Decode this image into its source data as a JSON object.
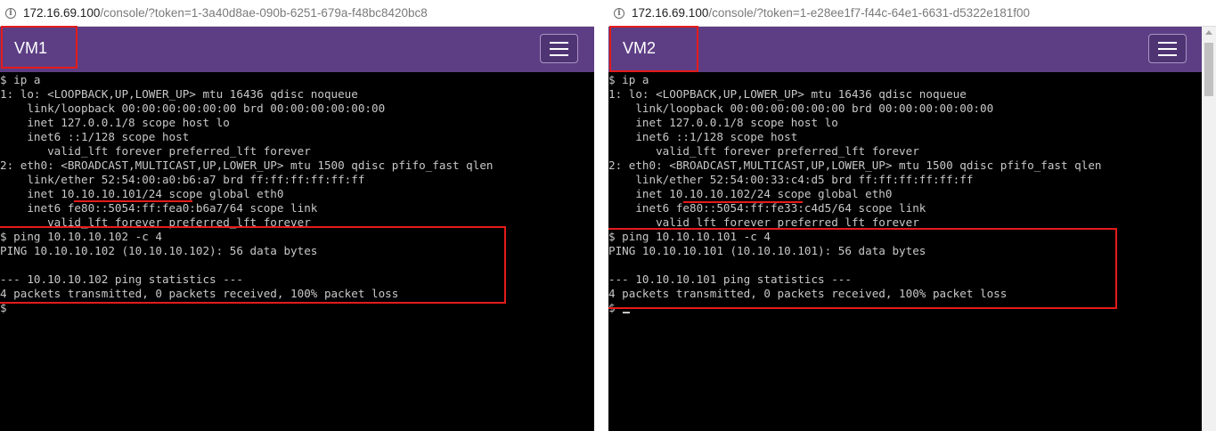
{
  "vm1": {
    "url": {
      "host": "172.16.69.100",
      "path": "/console/?token=1-3a40d8ae-090b-6251-679a-f48bc8420bc8"
    },
    "title": "VM1",
    "terminal_lines": [
      "$ ip a",
      "1: lo: <LOOPBACK,UP,LOWER_UP> mtu 16436 qdisc noqueue",
      "    link/loopback 00:00:00:00:00:00 brd 00:00:00:00:00:00",
      "    inet 127.0.0.1/8 scope host lo",
      "    inet6 ::1/128 scope host",
      "       valid_lft forever preferred_lft forever",
      "2: eth0: <BROADCAST,MULTICAST,UP,LOWER_UP> mtu 1500 qdisc pfifo_fast qlen",
      "    link/ether 52:54:00:a0:b6:a7 brd ff:ff:ff:ff:ff:ff",
      "    inet 10.10.10.101/24 scope global eth0",
      "    inet6 fe80::5054:ff:fea0:b6a7/64 scope link",
      "       valid_lft forever preferred_lft forever",
      "$ ping 10.10.10.102 -c 4",
      "PING 10.10.10.102 (10.10.10.102): 56 data bytes",
      "",
      "--- 10.10.10.102 ping statistics ---",
      "4 packets transmitted, 0 packets received, 100% packet loss",
      "$"
    ]
  },
  "vm2": {
    "url": {
      "host": "172.16.69.100",
      "path": "/console/?token=1-e28ee1f7-f44c-64e1-6631-d5322e181f00"
    },
    "title": "VM2",
    "terminal_lines": [
      "$ ip a",
      "1: lo: <LOOPBACK,UP,LOWER_UP> mtu 16436 qdisc noqueue",
      "    link/loopback 00:00:00:00:00:00 brd 00:00:00:00:00:00",
      "    inet 127.0.0.1/8 scope host lo",
      "    inet6 ::1/128 scope host",
      "       valid_lft forever preferred_lft forever",
      "2: eth0: <BROADCAST,MULTICAST,UP,LOWER_UP> mtu 1500 qdisc pfifo_fast qlen",
      "    link/ether 52:54:00:33:c4:d5 brd ff:ff:ff:ff:ff:ff",
      "    inet 10.10.10.102/24 scope global eth0",
      "    inet6 fe80::5054:ff:fe33:c4d5/64 scope link",
      "       valid_lft forever preferred_lft forever",
      "$ ping 10.10.10.101 -c 4",
      "PING 10.10.10.101 (10.10.10.101): 56 data bytes",
      "",
      "--- 10.10.10.101 ping statistics ---",
      "4 packets transmitted, 0 packets received, 100% packet loss",
      "$ "
    ]
  },
  "icons": {
    "site_info": "info-icon",
    "menu": "hamburger-menu-icon"
  },
  "colors": {
    "navbar": "#5d3e84",
    "terminal_bg": "#000000",
    "terminal_fg": "#c8c8c8",
    "annotation": "#e41b1b"
  }
}
